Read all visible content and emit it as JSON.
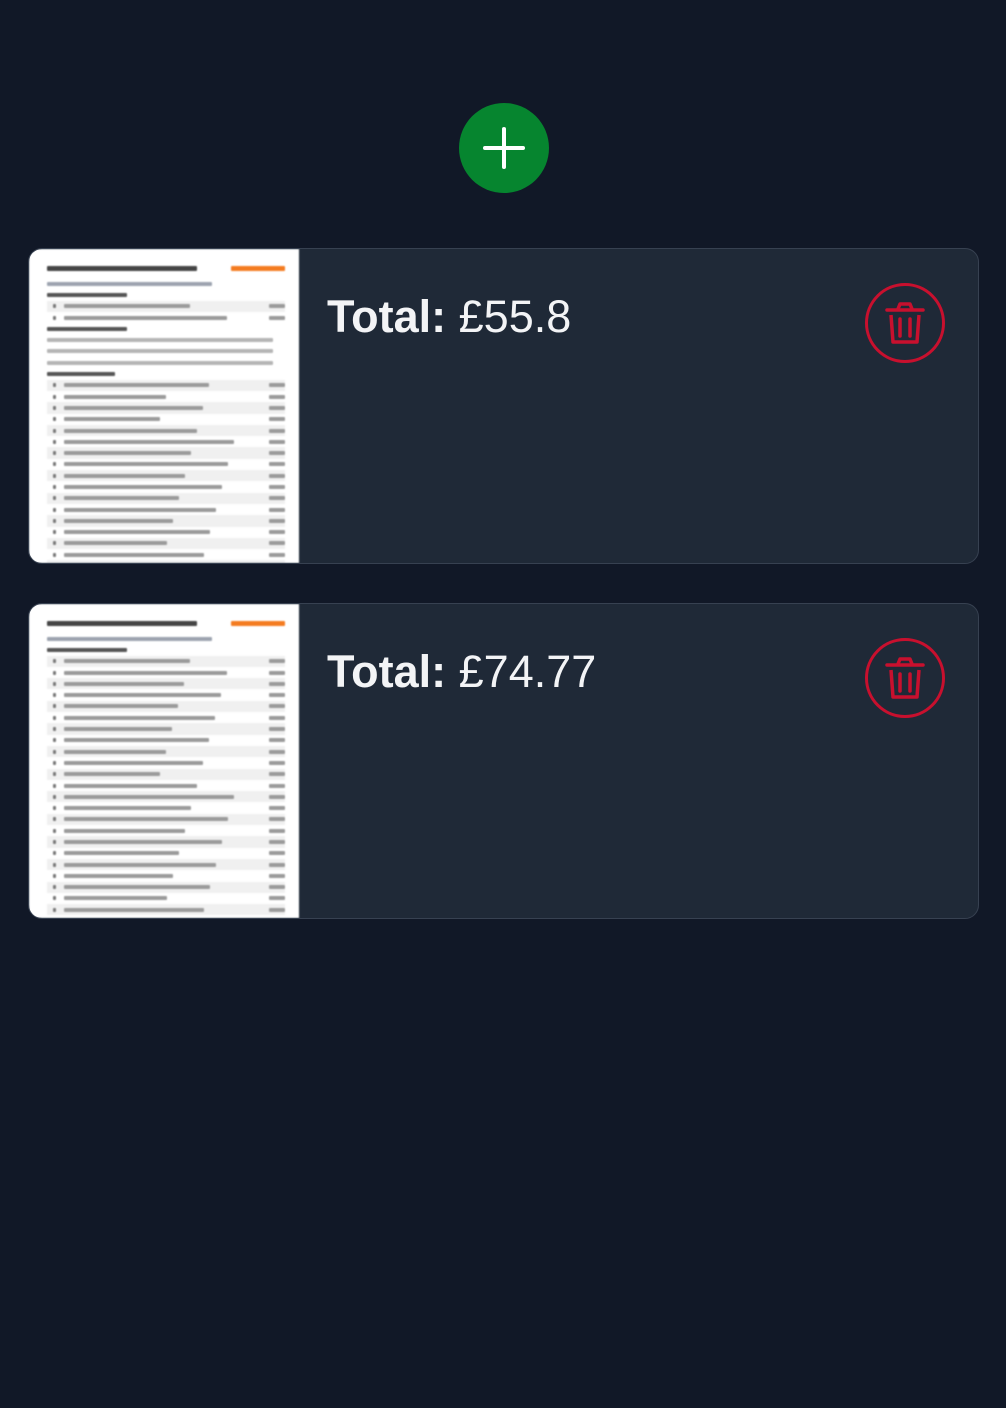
{
  "add_button": {
    "icon": "plus-icon",
    "color": "#06852f"
  },
  "receipts": [
    {
      "total_label": "Total:",
      "total_value": "£55.8",
      "delete_icon": "trash-icon",
      "thumbnail_rows": [
        "heading",
        "sub",
        "section",
        "item",
        "item",
        "section",
        "para",
        "para",
        "para",
        "section",
        "item",
        "item",
        "item",
        "item",
        "item",
        "item",
        "item",
        "item",
        "item",
        "item",
        "item",
        "item",
        "item",
        "item",
        "item",
        "item",
        "item",
        "item",
        "item"
      ]
    },
    {
      "total_label": "Total:",
      "total_value": "£74.77",
      "delete_icon": "trash-icon",
      "thumbnail_rows": [
        "heading",
        "sub",
        "section",
        "item",
        "item",
        "item",
        "item",
        "item",
        "item",
        "item",
        "item",
        "item",
        "item",
        "item",
        "item",
        "item",
        "item",
        "item",
        "item",
        "item",
        "item",
        "item",
        "item",
        "item",
        "item",
        "item"
      ]
    }
  ],
  "colors": {
    "background": "#111827",
    "card": "#1f2937",
    "delete": "#c8102e",
    "brand_text": "#f47b20"
  }
}
